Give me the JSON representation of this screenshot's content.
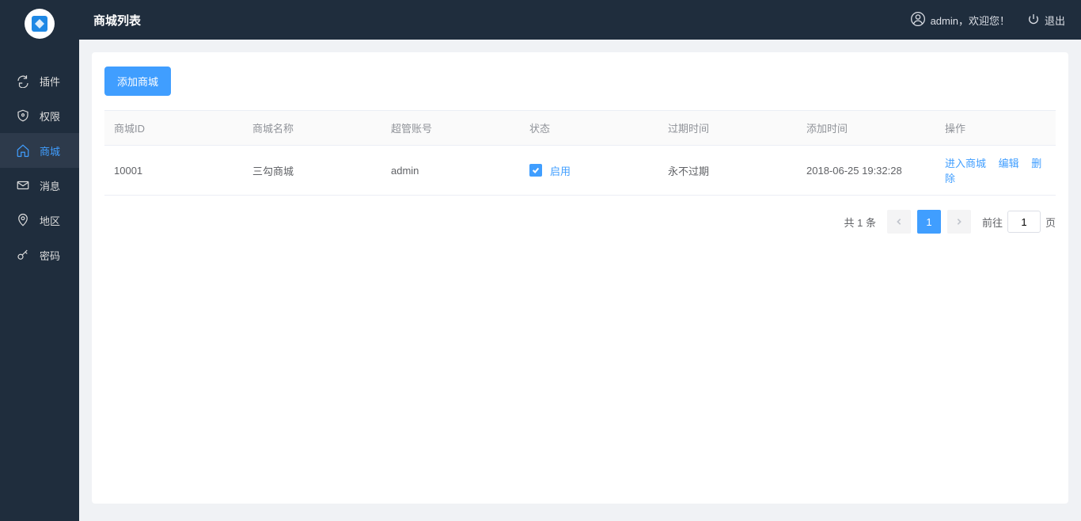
{
  "header": {
    "title": "商城列表",
    "user_greeting": "admin，欢迎您！",
    "logout_label": "退出"
  },
  "sidebar": {
    "items": [
      {
        "label": "插件"
      },
      {
        "label": "权限"
      },
      {
        "label": "商城"
      },
      {
        "label": "消息"
      },
      {
        "label": "地区"
      },
      {
        "label": "密码"
      }
    ]
  },
  "page": {
    "add_button": "添加商城",
    "columns": {
      "id": "商城ID",
      "name": "商城名称",
      "admin": "超管账号",
      "status": "状态",
      "expire": "过期时间",
      "created": "添加时间",
      "ops": "操作"
    },
    "rows": [
      {
        "id": "10001",
        "name": "三勾商城",
        "admin": "admin",
        "status": "启用",
        "expire": "永不过期",
        "created": "2018-06-25 19:32:28"
      }
    ],
    "actions": {
      "enter": "进入商城",
      "edit": "编辑",
      "del": "删除"
    },
    "pagination": {
      "total_text": "共 1 条",
      "current": "1",
      "jump_prefix": "前往",
      "jump_value": "1",
      "jump_suffix": "页"
    }
  }
}
